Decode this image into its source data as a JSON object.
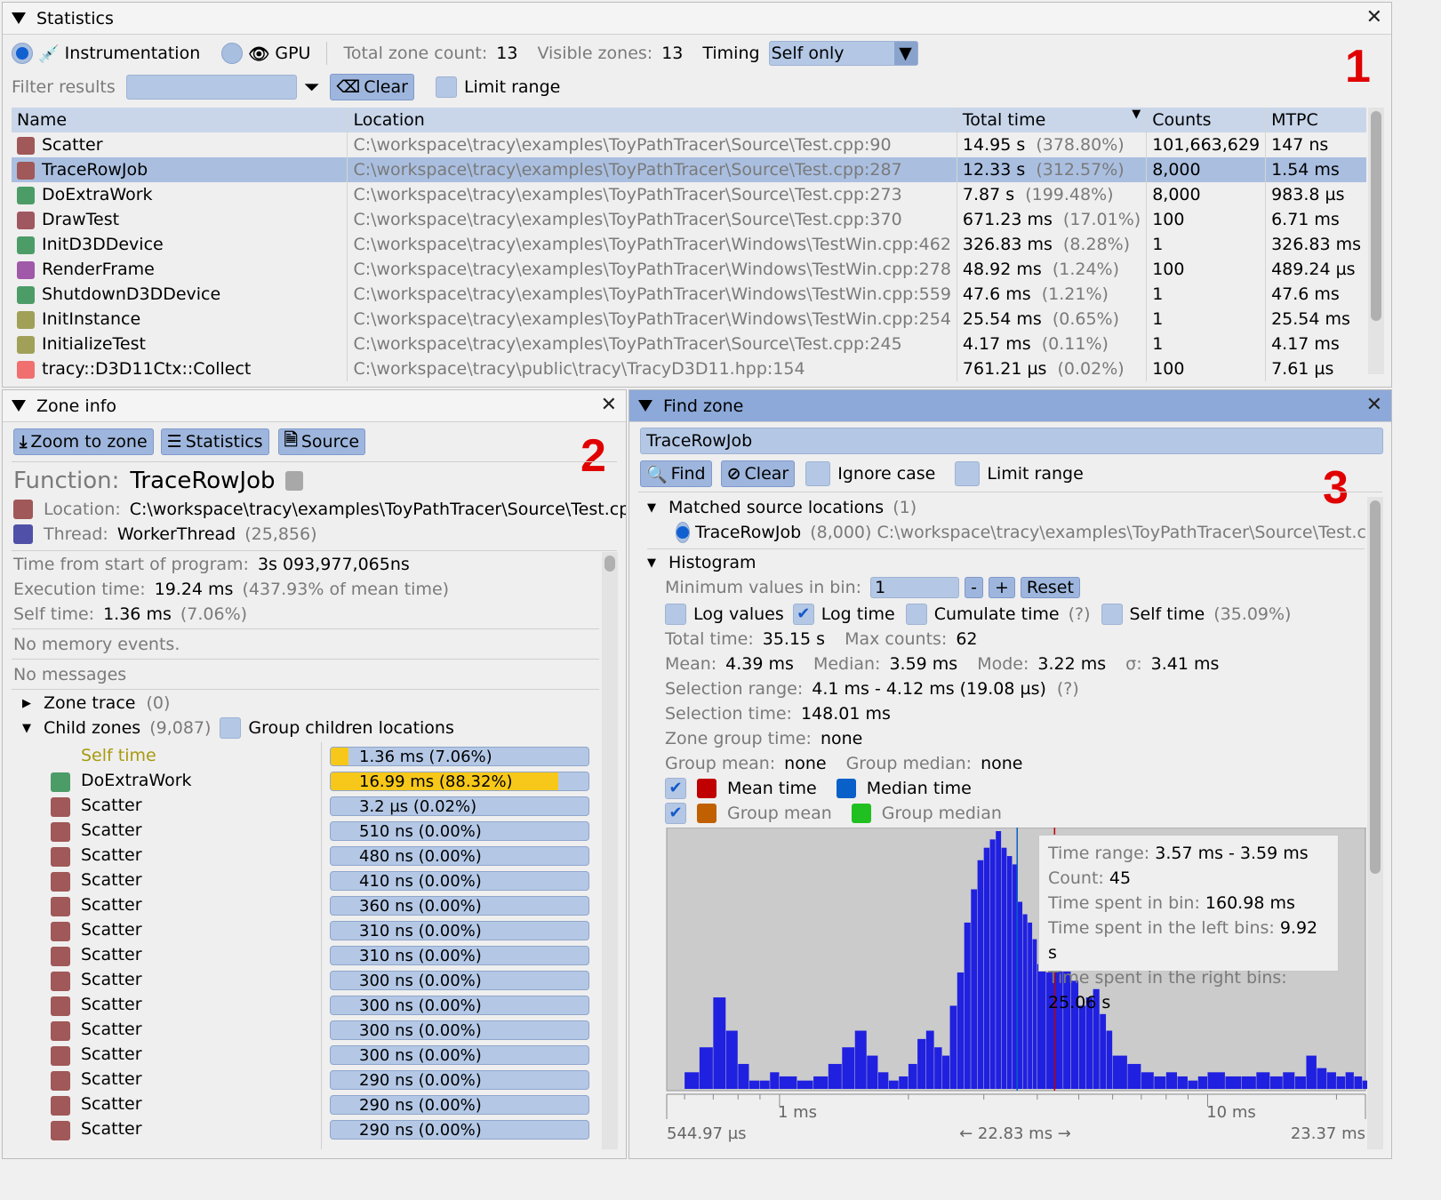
{
  "stats": {
    "title": "Statistics",
    "mode_instr": "Instrumentation",
    "mode_gpu": "GPU",
    "total_zone_label": "Total zone count:",
    "total_zone_value": "13",
    "visible_label": "Visible zones:",
    "visible_value": "13",
    "timing_label": "Timing",
    "timing_value": "Self only",
    "filter_label": "Filter results",
    "clear_label": "Clear",
    "limit_range": "Limit range",
    "marker": "1",
    "columns": [
      "Name",
      "Location",
      "Total time",
      "Counts",
      "MTPC"
    ],
    "rows": [
      {
        "name": "Scatter",
        "loc": "C:\\workspace\\tracy\\examples\\ToyPathTracer\\Source\\Test.cpp:90",
        "time": "14.95 s",
        "pct": "(378.80%)",
        "count": "101,663,629",
        "mtpc": "147 ns",
        "color": "#a05858"
      },
      {
        "name": "TraceRowJob",
        "loc": "C:\\workspace\\tracy\\examples\\ToyPathTracer\\Source\\Test.cpp:287",
        "time": "12.33 s",
        "pct": "(312.57%)",
        "count": "8,000",
        "mtpc": "1.54 ms",
        "color": "#a05858"
      },
      {
        "name": "DoExtraWork",
        "loc": "C:\\workspace\\tracy\\examples\\ToyPathTracer\\Source\\Test.cpp:273",
        "time": "7.87 s",
        "pct": "(199.48%)",
        "count": "8,000",
        "mtpc": "983.8 µs",
        "color": "#4c9c68"
      },
      {
        "name": "DrawTest",
        "loc": "C:\\workspace\\tracy\\examples\\ToyPathTracer\\Source\\Test.cpp:370",
        "time": "671.23 ms",
        "pct": "(17.01%)",
        "count": "100",
        "mtpc": "6.71 ms",
        "color": "#a05860"
      },
      {
        "name": "InitD3DDevice",
        "loc": "C:\\workspace\\tracy\\examples\\ToyPathTracer\\Windows\\TestWin.cpp:462",
        "time": "326.83 ms",
        "pct": "(8.28%)",
        "count": "1",
        "mtpc": "326.83 ms",
        "color": "#4c9c68"
      },
      {
        "name": "RenderFrame",
        "loc": "C:\\workspace\\tracy\\examples\\ToyPathTracer\\Windows\\TestWin.cpp:278",
        "time": "48.92 ms",
        "pct": "(1.24%)",
        "count": "100",
        "mtpc": "489.24 µs",
        "color": "#a058a8"
      },
      {
        "name": "ShutdownD3DDevice",
        "loc": "C:\\workspace\\tracy\\examples\\ToyPathTracer\\Windows\\TestWin.cpp:559",
        "time": "47.6 ms",
        "pct": "(1.21%)",
        "count": "1",
        "mtpc": "47.6 ms",
        "color": "#4c9c68"
      },
      {
        "name": "InitInstance",
        "loc": "C:\\workspace\\tracy\\examples\\ToyPathTracer\\Windows\\TestWin.cpp:254",
        "time": "25.54 ms",
        "pct": "(0.65%)",
        "count": "1",
        "mtpc": "25.54 ms",
        "color": "#a0a058"
      },
      {
        "name": "InitializeTest",
        "loc": "C:\\workspace\\tracy\\examples\\ToyPathTracer\\Source\\Test.cpp:245",
        "time": "4.17 ms",
        "pct": "(0.11%)",
        "count": "1",
        "mtpc": "4.17 ms",
        "color": "#a0a058"
      },
      {
        "name": "tracy::D3D11Ctx::Collect",
        "loc": "C:\\workspace\\tracy\\public\\tracy\\TracyD3D11.hpp:154",
        "time": "761.21 µs",
        "pct": "(0.02%)",
        "count": "100",
        "mtpc": "7.61 µs",
        "color": "#f07070"
      }
    ]
  },
  "zone": {
    "title": "Zone info",
    "zoom_btn": "Zoom to zone",
    "stats_btn": "Statistics",
    "source_btn": "Source",
    "marker": "2",
    "func_label": "Function:",
    "func_value": "TraceRowJob",
    "loc_label": "Location:",
    "loc_value": "C:\\workspace\\tracy\\examples\\ToyPathTracer\\Source\\Test.cpp:287",
    "thread_label": "Thread:",
    "thread_value": "WorkerThread",
    "thread_id": "(25,856)",
    "start_label": "Time from start of program:",
    "start_value": "3s 093,977,065ns",
    "exec_label": "Execution time:",
    "exec_value": "19.24 ms",
    "exec_pct": "(437.93% of mean time)",
    "self_label": "Self time:",
    "self_value": "1.36 ms",
    "self_pct": "(7.06%)",
    "no_mem": "No memory events.",
    "no_msg": "No messages",
    "zone_trace": "Zone trace",
    "zone_trace_count": "(0)",
    "child_zones": "Child zones",
    "child_count": "(9,087)",
    "group_children": "Group children locations",
    "children": [
      {
        "name": "Self time",
        "value": "1.36 ms (7.06%)",
        "fill": 0.0706,
        "self": true
      },
      {
        "name": "DoExtraWork",
        "value": "16.99 ms (88.32%)",
        "fill": 0.8832,
        "color": "#4c9c68"
      },
      {
        "name": "Scatter",
        "value": "3.2 µs (0.02%)",
        "fill": 0,
        "color": "#a05858"
      },
      {
        "name": "Scatter",
        "value": "510 ns (0.00%)",
        "fill": 0,
        "color": "#a05858"
      },
      {
        "name": "Scatter",
        "value": "480 ns (0.00%)",
        "fill": 0,
        "color": "#a05858"
      },
      {
        "name": "Scatter",
        "value": "410 ns (0.00%)",
        "fill": 0,
        "color": "#a05858"
      },
      {
        "name": "Scatter",
        "value": "360 ns (0.00%)",
        "fill": 0,
        "color": "#a05858"
      },
      {
        "name": "Scatter",
        "value": "310 ns (0.00%)",
        "fill": 0,
        "color": "#a05858"
      },
      {
        "name": "Scatter",
        "value": "310 ns (0.00%)",
        "fill": 0,
        "color": "#a05858"
      },
      {
        "name": "Scatter",
        "value": "300 ns (0.00%)",
        "fill": 0,
        "color": "#a05858"
      },
      {
        "name": "Scatter",
        "value": "300 ns (0.00%)",
        "fill": 0,
        "color": "#a05858"
      },
      {
        "name": "Scatter",
        "value": "300 ns (0.00%)",
        "fill": 0,
        "color": "#a05858"
      },
      {
        "name": "Scatter",
        "value": "300 ns (0.00%)",
        "fill": 0,
        "color": "#a05858"
      },
      {
        "name": "Scatter",
        "value": "290 ns (0.00%)",
        "fill": 0,
        "color": "#a05858"
      },
      {
        "name": "Scatter",
        "value": "290 ns (0.00%)",
        "fill": 0,
        "color": "#a05858"
      },
      {
        "name": "Scatter",
        "value": "290 ns (0.00%)",
        "fill": 0,
        "color": "#a05858"
      }
    ]
  },
  "find": {
    "title": "Find zone",
    "query": "TraceRowJob",
    "find_btn": "Find",
    "clear_btn": "Clear",
    "ignore_case": "Ignore case",
    "limit_range": "Limit range",
    "marker": "3",
    "matched_label": "Matched source locations",
    "matched_count": "(1)",
    "match_name": "TraceRowJob",
    "match_detail": "(8,000) C:\\workspace\\tracy\\examples\\ToyPathTracer\\Source\\Test.cpp:287",
    "histogram_label": "Histogram",
    "min_bin_label": "Minimum values in bin:",
    "min_bin_value": "1",
    "minus": "-",
    "plus": "+",
    "reset": "Reset",
    "log_values": "Log values",
    "log_time": "Log time",
    "cumulate": "Cumulate time",
    "q": "(?)",
    "self_time": "Self time",
    "self_pct": "(35.09%)",
    "total_label": "Total time:",
    "total_value": "35.15 s",
    "max_label": "Max counts:",
    "max_value": "62",
    "mean_label": "Mean:",
    "mean_value": "4.39 ms",
    "median_label": "Median:",
    "median_value": "3.59 ms",
    "mode_label": "Mode:",
    "mode_value": "3.22 ms",
    "sigma_label": "σ:",
    "sigma_value": "3.41 ms",
    "selrange_label": "Selection range:",
    "selrange_value": "4.1 ms - 4.12 ms (19.08 µs)",
    "seltime_label": "Selection time:",
    "seltime_value": "148.01 ms",
    "zgt_label": "Zone group time:",
    "zgt_value": "none",
    "gmean_label": "Group mean:",
    "gmean_value": "none",
    "gmedian_label": "Group median:",
    "gmedian_value": "none",
    "legend_mean": "Mean time",
    "legend_median": "Median time",
    "legend_gmean": "Group mean",
    "legend_gmedian": "Group median",
    "colors": {
      "mean": "#c00000",
      "median": "#0860c8",
      "gmean": "#c06000",
      "gmedian": "#20c020",
      "hist": "#2020e0"
    },
    "tooltip": {
      "range_label": "Time range:",
      "range_value": "3.57 ms - 3.59 ms",
      "count_label": "Count:",
      "count_value": "45",
      "bin_label": "Time spent in bin:",
      "bin_value": "160.98 ms",
      "left_label": "Time spent in the left bins:",
      "left_value": "9.92 s",
      "right_label": "Time spent in the right bins:",
      "right_value": "25.06 s"
    },
    "axis_min": "544.97 µs",
    "axis_span": "← 22.83 ms →",
    "axis_max": "23.37 ms",
    "tick_1": "1 ms",
    "tick_10": "10 ms"
  },
  "chart_data": {
    "type": "bar",
    "xscale": "log",
    "xlim": [
      0.54497,
      23.37
    ],
    "xunit": "ms",
    "ylim": [
      0,
      62
    ],
    "xticks": [
      "1 ms",
      "10 ms"
    ],
    "lines": {
      "mean": 4.39,
      "median": 3.59
    },
    "x": [
      0.6,
      0.65,
      0.7,
      0.75,
      0.8,
      0.85,
      0.9,
      0.95,
      1.0,
      1.1,
      1.2,
      1.3,
      1.4,
      1.5,
      1.6,
      1.7,
      1.8,
      1.9,
      2.0,
      2.1,
      2.2,
      2.3,
      2.4,
      2.5,
      2.6,
      2.7,
      2.8,
      2.9,
      3.0,
      3.1,
      3.2,
      3.3,
      3.4,
      3.5,
      3.6,
      3.7,
      3.8,
      3.9,
      4.0,
      4.2,
      4.4,
      4.6,
      4.8,
      5.0,
      5.2,
      5.4,
      5.6,
      5.8,
      6.0,
      6.5,
      7.0,
      7.5,
      8.0,
      8.5,
      9.0,
      9.5,
      10,
      11,
      12,
      13,
      14,
      15,
      16,
      17,
      18,
      19,
      20,
      21,
      22,
      23
    ],
    "values": [
      4,
      10,
      22,
      14,
      6,
      2,
      2,
      4,
      3,
      2,
      3,
      6,
      10,
      14,
      8,
      4,
      2,
      3,
      6,
      12,
      14,
      10,
      8,
      20,
      28,
      40,
      48,
      55,
      58,
      60,
      62,
      58,
      56,
      54,
      45,
      42,
      40,
      36,
      30,
      28,
      34,
      30,
      26,
      20,
      22,
      24,
      18,
      14,
      8,
      6,
      4,
      3,
      4,
      3,
      2,
      3,
      4,
      3,
      3,
      4,
      3,
      4,
      3,
      8,
      5,
      4,
      3,
      4,
      3,
      2
    ]
  }
}
